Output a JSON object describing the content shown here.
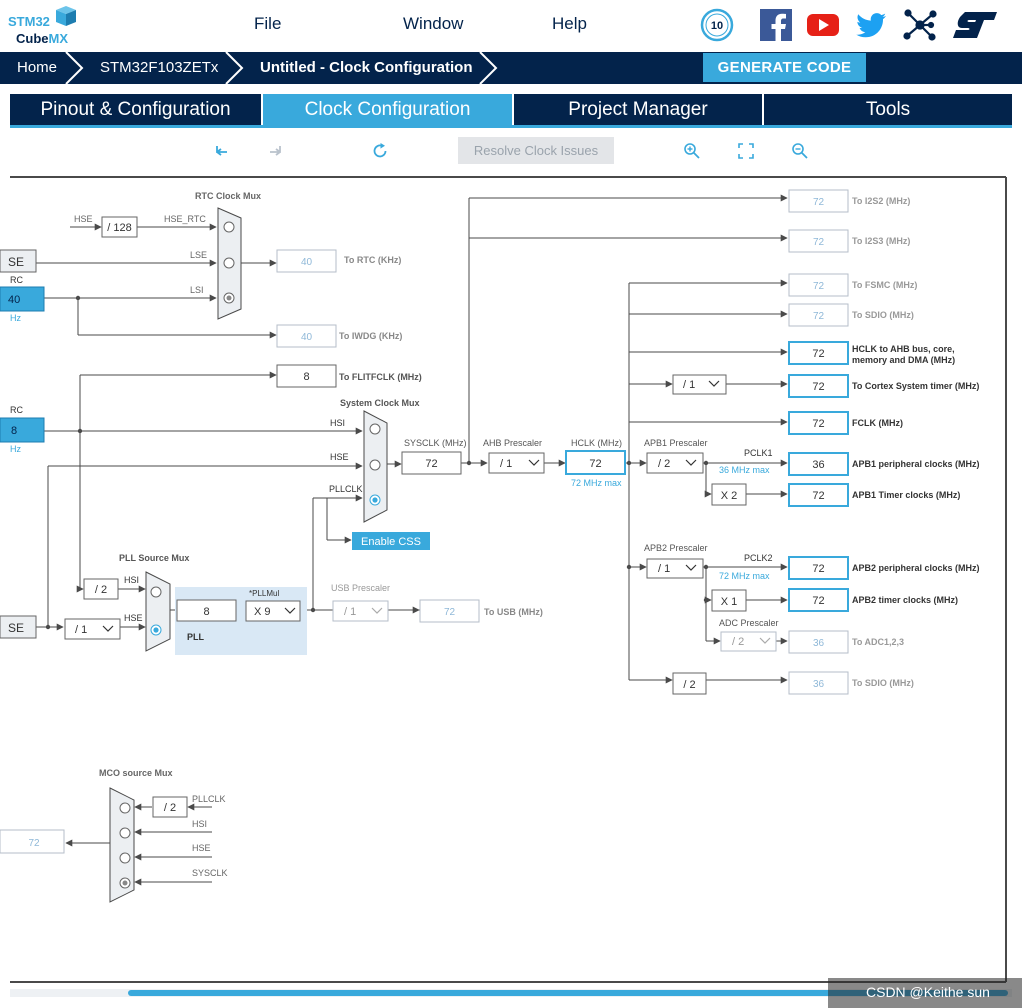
{
  "app": {
    "logo": {
      "line1": "STM32",
      "line2": "Cube",
      "line3": "MX"
    },
    "menu": [
      "File",
      "Window",
      "Help"
    ],
    "social_icons": [
      "10-years-badge-icon",
      "facebook-icon",
      "youtube-icon",
      "twitter-icon",
      "network-icon",
      "st-logo-icon"
    ],
    "anniversary_badge": "10"
  },
  "breadcrumb": [
    "Home",
    "STM32F103ZETx",
    "Untitled - Clock Configuration"
  ],
  "generate_button": "GENERATE CODE",
  "tabs": [
    {
      "label": "Pinout & Configuration",
      "active": false
    },
    {
      "label": "Clock Configuration",
      "active": true
    },
    {
      "label": "Project Manager",
      "active": false
    },
    {
      "label": "Tools",
      "active": false
    }
  ],
  "toolbar": {
    "resolve_label": "Resolve Clock Issues",
    "icons": [
      "undo-icon",
      "redo-icon",
      "refresh-icon",
      "zoom-in-icon",
      "fit-screen-icon",
      "zoom-out-icon"
    ]
  },
  "colors": {
    "navy": "#03234b",
    "accent": "#39a9dc",
    "line": "#4a4a4a",
    "muted": "#8a96a3",
    "pll_bg": "#d9e8f5"
  },
  "clock": {
    "rtc_mux_title": "RTC Clock Mux",
    "rtc_inputs": [
      "HSE",
      "LSE",
      "LSI"
    ],
    "hse_rtc_label": "HSE_RTC",
    "hse_rtc_div": "/ 128",
    "lse_box": "SE",
    "lsi_rc_label": "RC",
    "lsi_value": "40",
    "lsi_unit": "Hz",
    "hsi_rc_label": "RC",
    "hsi_value": "8",
    "hsi_unit": "Hz",
    "hse_box": "SE",
    "rtc_out": {
      "value": "40",
      "label": "To RTC (KHz)"
    },
    "iwdg_out": {
      "value": "40",
      "label": "To IWDG (KHz)"
    },
    "flit_out": {
      "value": "8",
      "label": "To FLITFCLK (MHz)"
    },
    "sys_mux_title": "System Clock Mux",
    "sys_inputs": [
      "HSI",
      "HSE",
      "PLLCLK"
    ],
    "enable_css": "Enable CSS",
    "sysclk_label": "SYSCLK (MHz)",
    "sysclk_value": "72",
    "ahb_prescaler_label": "AHB Prescaler",
    "ahb_prescaler": "/ 1",
    "hclk_label": "HCLK (MHz)",
    "hclk_value": "72",
    "hclk_max": "72 MHz max",
    "pll_src_title": "PLL Source Mux",
    "pll_src_inputs": [
      "HSI",
      "HSE"
    ],
    "pll_hsi_div": "/ 2",
    "hse_prediv": "/ 1",
    "pll_in_value": "8",
    "pll_label": "PLL",
    "pllmul_label": "*PLLMul",
    "pllmul_value": "X 9",
    "usb_prescaler_label": "USB Prescaler",
    "usb_prescaler": "/ 1",
    "usb_out": {
      "value": "72",
      "label": "To USB (MHz)"
    },
    "apb1_prescaler_label": "APB1 Prescaler",
    "apb1_prescaler": "/ 2",
    "pclk1_label": "PCLK1",
    "pclk1_max": "36 MHz max",
    "apb1_timer_mul": "X 2",
    "apb2_prescaler_label": "APB2 Prescaler",
    "apb2_prescaler": "/ 1",
    "pclk2_label": "PCLK2",
    "pclk2_max": "72 MHz max",
    "apb2_timer_mul": "X 1",
    "adc_prescaler_label": "ADC Prescaler",
    "adc_prescaler": "/ 2",
    "cortex_div": "/ 1",
    "sdio_div": "/ 2",
    "outputs": [
      {
        "value": "72",
        "label": "To I2S2 (MHz)",
        "active": false
      },
      {
        "value": "72",
        "label": "To I2S3 (MHz)",
        "active": false
      },
      {
        "value": "72",
        "label": "To FSMC (MHz)",
        "active": false
      },
      {
        "value": "72",
        "label": "To SDIO (MHz)",
        "active": false
      },
      {
        "value": "72",
        "label": "HCLK to AHB bus, core, memory and DMA (MHz)",
        "active": true
      },
      {
        "value": "72",
        "label": "To Cortex System timer (MHz)",
        "active": true
      },
      {
        "value": "72",
        "label": "FCLK (MHz)",
        "active": true
      },
      {
        "value": "36",
        "label": "APB1 peripheral clocks (MHz)",
        "active": true
      },
      {
        "value": "72",
        "label": "APB1 Timer clocks (MHz)",
        "active": true
      },
      {
        "value": "72",
        "label": "APB2 peripheral clocks (MHz)",
        "active": true
      },
      {
        "value": "72",
        "label": "APB2 timer clocks (MHz)",
        "active": true
      },
      {
        "value": "36",
        "label": "To ADC1,2,3",
        "active": false
      },
      {
        "value": "36",
        "label": "To SDIO (MHz)",
        "active": false
      }
    ],
    "mco_title": "MCO source Mux",
    "mco_inputs": [
      "PLLCLK",
      "HSI",
      "HSE",
      "SYSCLK"
    ],
    "mco_div": "/ 2",
    "mco_out_value": "72"
  },
  "watermark": "CSDN @Keithe sun"
}
